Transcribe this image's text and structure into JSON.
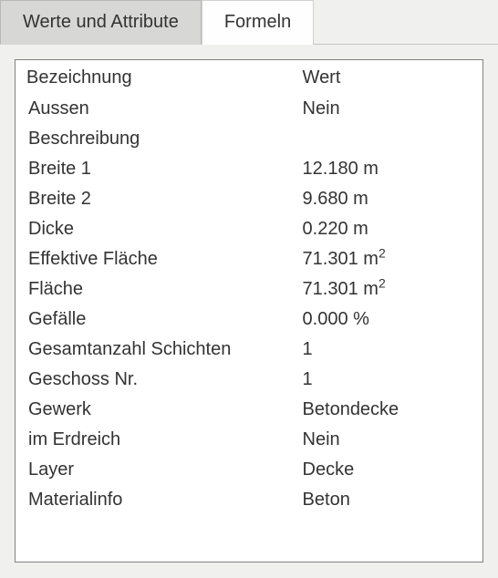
{
  "tabs": {
    "values_attributes": "Werte und Attribute",
    "formulas": "Formeln"
  },
  "table": {
    "header_label": "Bezeichnung",
    "header_value": "Wert",
    "rows": [
      {
        "label": "Aussen",
        "value": "Nein"
      },
      {
        "label": "Beschreibung",
        "value": ""
      },
      {
        "label": "Breite 1",
        "value": "12.180 m"
      },
      {
        "label": "Breite 2",
        "value": "9.680 m"
      },
      {
        "label": "Dicke",
        "value": "0.220 m"
      },
      {
        "label": "Effektive Fläche",
        "value": "71.301 m²"
      },
      {
        "label": "Fläche",
        "value": "71.301 m²"
      },
      {
        "label": "Gefälle",
        "value": "0.000 %"
      },
      {
        "label": "Gesamtanzahl Schichten",
        "value": "1"
      },
      {
        "label": "Geschoss Nr.",
        "value": "1"
      },
      {
        "label": "Gewerk",
        "value": "Betondecke"
      },
      {
        "label": "im Erdreich",
        "value": "Nein"
      },
      {
        "label": "Layer",
        "value": "Decke"
      },
      {
        "label": "Materialinfo",
        "value": "Beton"
      }
    ]
  }
}
